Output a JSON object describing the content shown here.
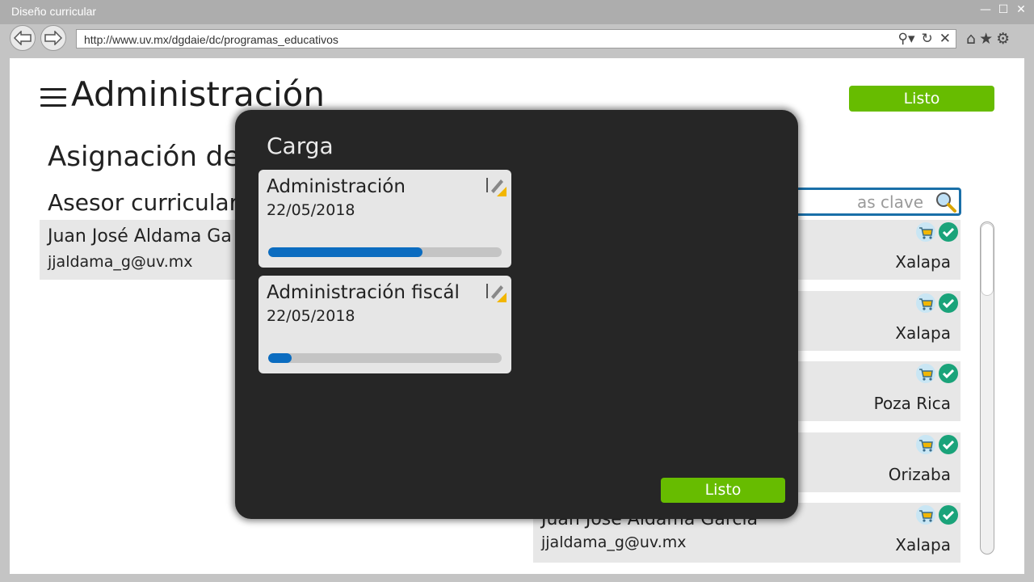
{
  "window": {
    "title": "Diseño curricular",
    "controls": [
      "—",
      "☐",
      "✕"
    ]
  },
  "browser": {
    "url": "http://www.uv.mx/dgdaie/dc/programas_educativos"
  },
  "header": {
    "title": "Administración",
    "done_label": "Listo"
  },
  "section": {
    "title": "Asignación de",
    "advisor_label": "Asesor curricular"
  },
  "advisor": {
    "name": "Juan José Aldama Ga",
    "email": "jjaldama_g@uv.mx"
  },
  "search": {
    "placeholder": "as clave"
  },
  "list": {
    "rows": [
      {
        "name": "",
        "email": "",
        "city": "Xalapa"
      },
      {
        "name": "",
        "email": "",
        "city": "Xalapa"
      },
      {
        "name": "",
        "email": "",
        "city": "Poza Rica"
      },
      {
        "name": "",
        "email": "",
        "city": "Orizaba"
      },
      {
        "name": "Juan José Aldama García",
        "email": "jjaldama_g@uv.mx",
        "city": "Xalapa"
      }
    ]
  },
  "modal": {
    "title": "Carga",
    "cards": [
      {
        "name": "Administración",
        "date": "22/05/2018",
        "progress": 0.66
      },
      {
        "name": "Administración fiscál",
        "date": "22/05/2018",
        "progress": 0.1
      }
    ],
    "done_label": "Listo"
  },
  "colors": {
    "accent_green": "#67bc00",
    "progress_blue": "#0b6cc0",
    "modal_bg": "#262626"
  }
}
